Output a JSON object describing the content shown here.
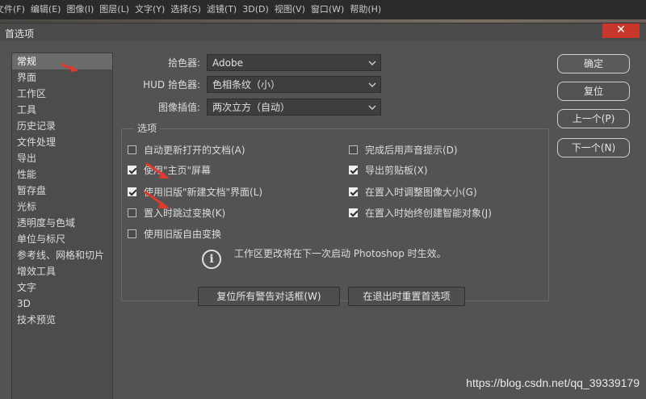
{
  "menubar": {
    "items": [
      "文件(F)",
      "编辑(E)",
      "图像(I)",
      "图层(L)",
      "文字(Y)",
      "选择(S)",
      "滤镜(T)",
      "3D(D)",
      "视图(V)",
      "窗口(W)",
      "帮助(H)"
    ]
  },
  "dialog": {
    "title": "首选项",
    "close_glyph": "✕"
  },
  "categories": [
    "常规",
    "界面",
    "工作区",
    "工具",
    "历史记录",
    "文件处理",
    "导出",
    "性能",
    "暂存盘",
    "光标",
    "透明度与色域",
    "单位与标尺",
    "参考线、网格和切片",
    "增效工具",
    "文字",
    "3D",
    "技术预览"
  ],
  "selected_category": "常规",
  "fields": {
    "color_picker_label": "拾色器:",
    "color_picker_value": "Adobe",
    "hud_picker_label": "HUD 拾色器:",
    "hud_picker_value": "色相条纹（小）",
    "interpolation_label": "图像插值:",
    "interpolation_value": "两次立方（自动）"
  },
  "options": {
    "legend": "选项",
    "left": [
      {
        "label": "自动更新打开的文档(A)",
        "checked": false
      },
      {
        "label": "使用\"主页\"屏幕",
        "checked": true
      },
      {
        "label": "使用旧版\"新建文档\"界面(L)",
        "checked": true
      },
      {
        "label": "置入时跳过变换(K)",
        "checked": false
      },
      {
        "label": "使用旧版自由变换",
        "checked": false
      }
    ],
    "right": [
      {
        "label": "完成后用声音提示(D)",
        "checked": false
      },
      {
        "label": "导出剪贴板(X)",
        "checked": true
      },
      {
        "label": "在置入时调整图像大小(G)",
        "checked": true
      },
      {
        "label": "在置入时始终创建智能对象(J)",
        "checked": true
      }
    ],
    "info_text": "工作区更改将在下一次启动 Photoshop 时生效。",
    "info_glyph": "i"
  },
  "buttons": {
    "ok": "确定",
    "reset": "复位",
    "prev": "上一个(P)",
    "next": "下一个(N)",
    "reset_warnings": "复位所有警告对话框(W)",
    "reset_on_quit": "在退出时重置首选项"
  },
  "watermark": "https://blog.csdn.net/qq_39339179",
  "colors": {
    "panel": "#535353",
    "annotation_arrow": "#e03a2f",
    "close_button": "#c9372c"
  }
}
